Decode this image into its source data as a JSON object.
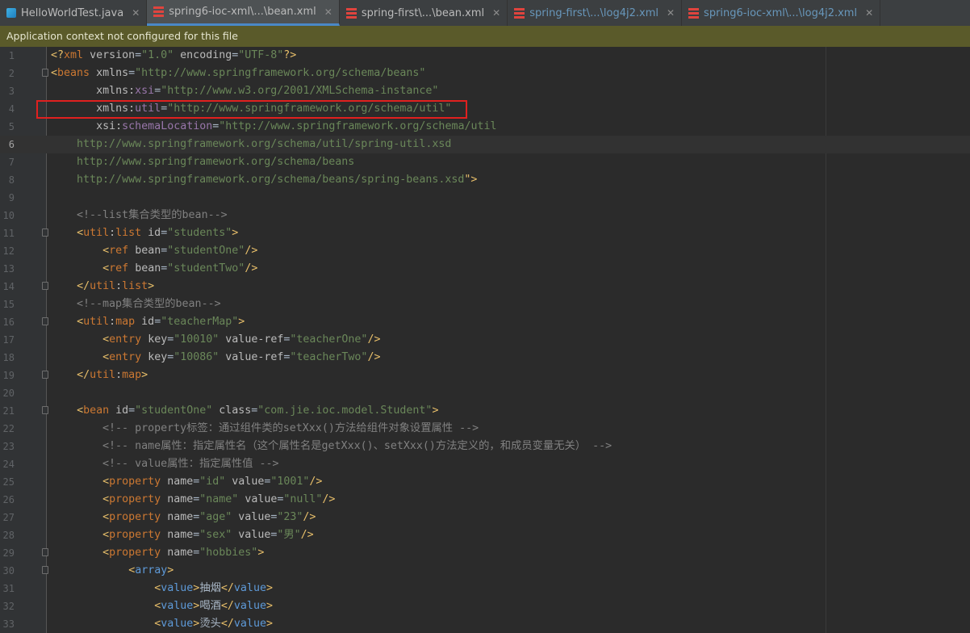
{
  "tabs": [
    {
      "label": "HelloWorldTest.java",
      "icon": "java-file-icon",
      "active": false,
      "link": false
    },
    {
      "label": "spring6-ioc-xml\\...\\bean.xml",
      "icon": "xml-file-icon",
      "active": true,
      "link": false
    },
    {
      "label": "spring-first\\...\\bean.xml",
      "icon": "xml-file-icon",
      "active": false,
      "link": false
    },
    {
      "label": "spring-first\\...\\log4j2.xml",
      "icon": "xml-file-icon",
      "active": false,
      "link": true
    },
    {
      "label": "spring6-ioc-xml\\...\\log4j2.xml",
      "icon": "xml-file-icon",
      "active": false,
      "link": true
    }
  ],
  "close_glyph": "✕",
  "banner": {
    "text": "Application context not configured for this file"
  },
  "editor": {
    "current_line": 6,
    "lines": [
      "<?xml version=\"1.0\" encoding=\"UTF-8\"?>",
      "<beans xmlns=\"http://www.springframework.org/schema/beans\"",
      "       xmlns:xsi=\"http://www.w3.org/2001/XMLSchema-instance\"",
      "       xmlns:util=\"http://www.springframework.org/schema/util\"",
      "       xsi:schemaLocation=\"http://www.springframework.org/schema/util",
      "    http://www.springframework.org/schema/util/spring-util.xsd",
      "    http://www.springframework.org/schema/beans",
      "    http://www.springframework.org/schema/beans/spring-beans.xsd\">",
      "",
      "    <!--list集合类型的bean-->",
      "    <util:list id=\"students\">",
      "        <ref bean=\"studentOne\"/>",
      "        <ref bean=\"studentTwo\"/>",
      "    </util:list>",
      "    <!--map集合类型的bean-->",
      "    <util:map id=\"teacherMap\">",
      "        <entry key=\"10010\" value-ref=\"teacherOne\"/>",
      "        <entry key=\"10086\" value-ref=\"teacherTwo\"/>",
      "    </util:map>",
      "",
      "    <bean id=\"studentOne\" class=\"com.jie.ioc.model.Student\">",
      "        <!-- property标签：通过组件类的setXxx()方法给组件对象设置属性 -->",
      "        <!-- name属性：指定属性名（这个属性名是getXxx()、setXxx()方法定义的，和成员变量无关） -->",
      "        <!-- value属性：指定属性值 -->",
      "        <property name=\"id\" value=\"1001\"/>",
      "        <property name=\"name\" value=\"null\"/>",
      "        <property name=\"age\" value=\"23\"/>",
      "        <property name=\"sex\" value=\"男\"/>",
      "        <property name=\"hobbies\">",
      "            <array>",
      "                <value>抽烟</value>",
      "                <value>喝酒</value>",
      "                <value>烫头</value>"
    ]
  }
}
